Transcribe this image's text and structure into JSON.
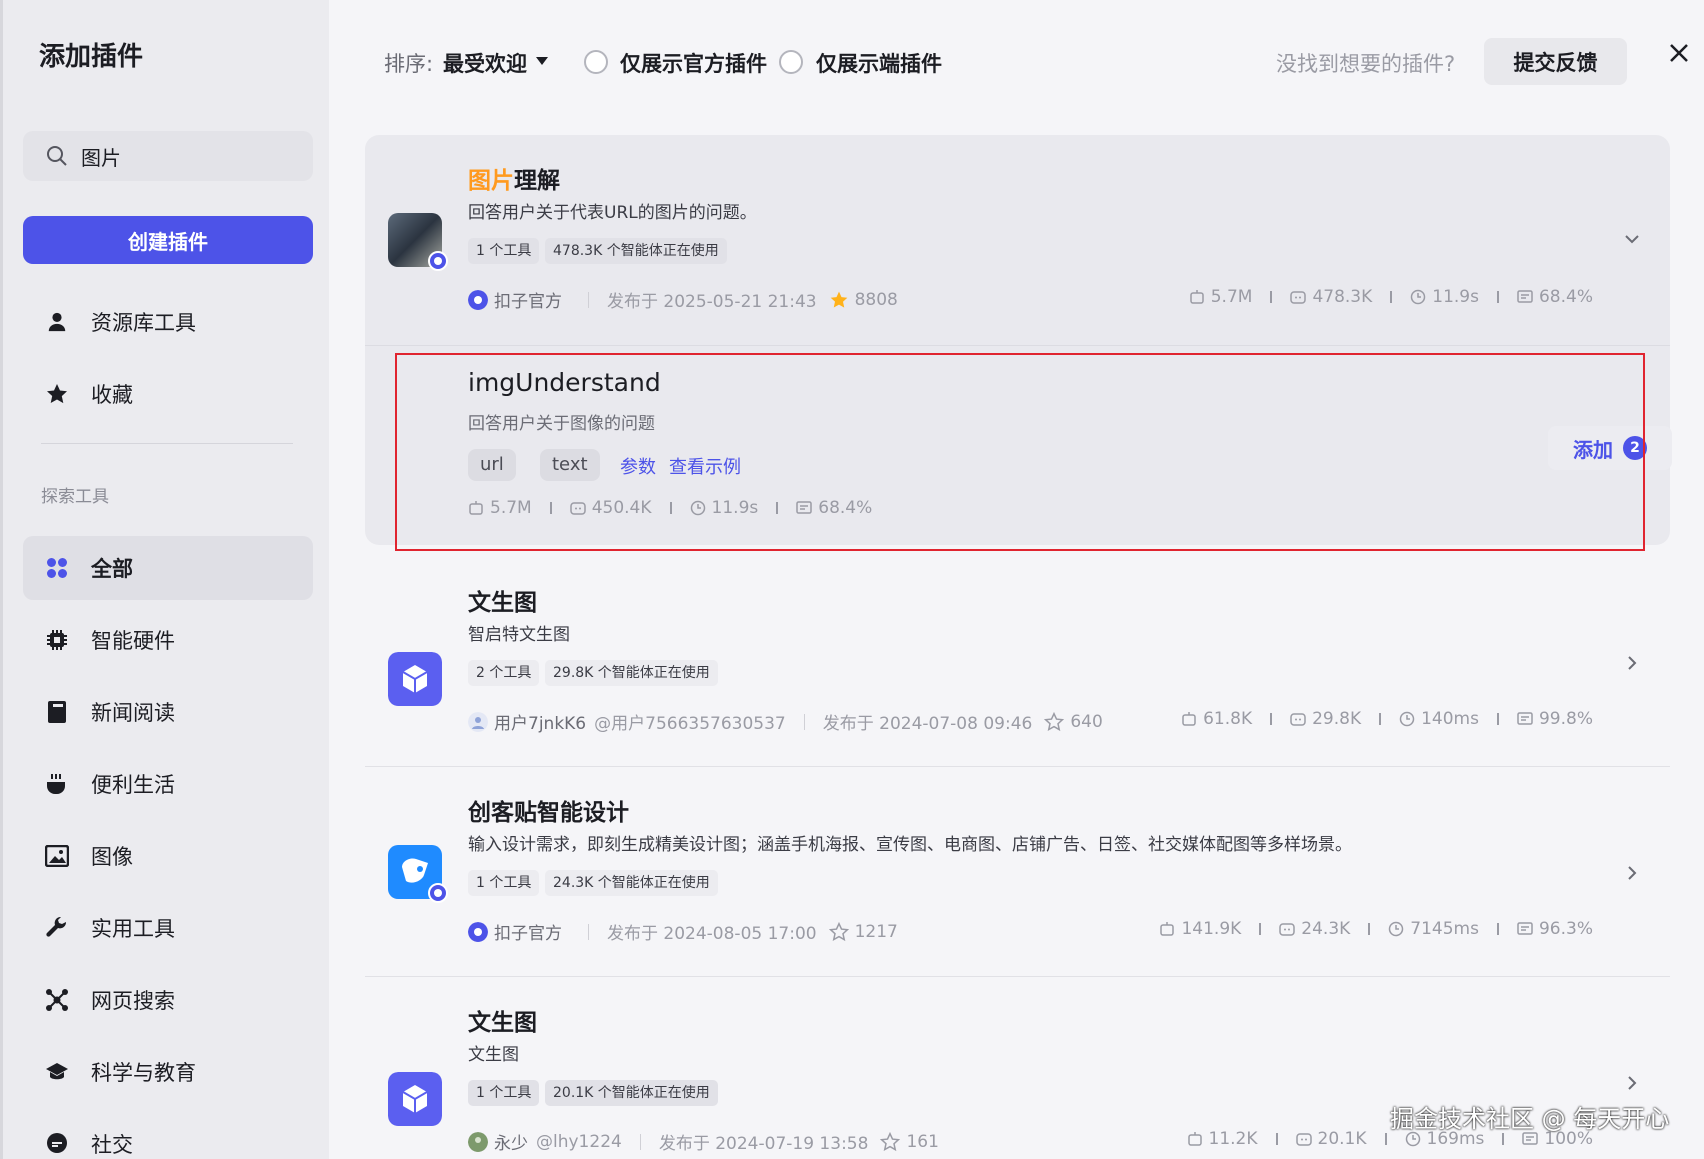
{
  "sidebar": {
    "title": "添加插件",
    "search_value": "图片",
    "create_label": "创建插件",
    "items_top": [
      {
        "label": "资源库工具",
        "icon": "person-icon"
      },
      {
        "label": "收藏",
        "icon": "star-icon"
      }
    ],
    "section_label": "探索工具",
    "items": [
      {
        "label": "全部",
        "icon": "grid-icon",
        "active": true
      },
      {
        "label": "智能硬件",
        "icon": "chip-icon"
      },
      {
        "label": "新闻阅读",
        "icon": "book-icon"
      },
      {
        "label": "便利生活",
        "icon": "cup-icon"
      },
      {
        "label": "图像",
        "icon": "image-icon"
      },
      {
        "label": "实用工具",
        "icon": "wrench-icon"
      },
      {
        "label": "网页搜索",
        "icon": "network-icon"
      },
      {
        "label": "科学与教育",
        "icon": "graduation-cap-icon"
      },
      {
        "label": "社交",
        "icon": "chat-icon"
      }
    ]
  },
  "header": {
    "sort_label": "排序:",
    "sort_value": "最受欢迎",
    "filter_official": "仅展示官方插件",
    "filter_device": "仅展示端插件",
    "not_found": "没找到想要的插件?",
    "feedback": "提交反馈"
  },
  "plugins": [
    {
      "title_hl": "图片",
      "title_rest": "理解",
      "desc": "回答用户关于代表URL的图片的问题。",
      "tag_tools": "1 个工具",
      "tag_users": "478.3K 个智能体正在使用",
      "author": "扣子官方",
      "published": "发布于 2025-05-21 21:43",
      "stars": "8808",
      "stats": [
        "5.7M",
        "478.3K",
        "11.9s",
        "68.4%"
      ],
      "tool": {
        "name": "imgUnderstand",
        "desc": "回答用户关于图像的问题",
        "params": [
          "url",
          "text"
        ],
        "link_params": "参数",
        "link_example": "查看示例",
        "stats": [
          "5.7M",
          "450.4K",
          "11.9s",
          "68.4%"
        ],
        "add_label": "添加",
        "add_count": "2"
      }
    },
    {
      "title": "文生图",
      "desc": "智启特文生图",
      "tag_tools": "2 个工具",
      "tag_users": "29.8K 个智能体正在使用",
      "author": "用户7jnkK6",
      "handle": "@用户7566357630537",
      "published": "发布于 2024-07-08 09:46",
      "stars": "640",
      "stats": [
        "61.8K",
        "29.8K",
        "140ms",
        "99.8%"
      ]
    },
    {
      "title": "创客贴智能设计",
      "desc": "输入设计需求，即刻生成精美设计图；涵盖手机海报、宣传图、电商图、店铺广告、日签、社交媒体配图等多样场景。",
      "tag_tools": "1 个工具",
      "tag_users": "24.3K 个智能体正在使用",
      "author": "扣子官方",
      "published": "发布于 2024-08-05 17:00",
      "stars": "1217",
      "stats": [
        "141.9K",
        "24.3K",
        "7145ms",
        "96.3%"
      ]
    },
    {
      "title": "文生图",
      "desc": "文生图",
      "tag_tools": "1 个工具",
      "tag_users": "20.1K 个智能体正在使用",
      "author": "永少",
      "handle": "@lhy1224",
      "published": "发布于 2024-07-19 13:58",
      "stars": "161",
      "stats": [
        "11.2K",
        "20.1K",
        "169ms",
        "100%"
      ]
    }
  ],
  "watermark": "掘金技术社区 @ 每天开心",
  "colors": {
    "accent": "#4d53e8",
    "highlight": "#ff9a1f",
    "annotation": "#e0242f"
  }
}
